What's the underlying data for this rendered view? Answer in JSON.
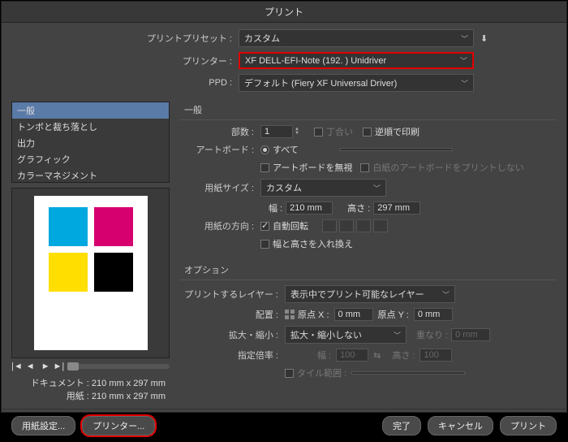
{
  "title": "プリント",
  "presets": {
    "label": "プリントプリセット :",
    "value": "カスタム"
  },
  "printer": {
    "label": "プリンター :",
    "value": "XF DELL-EFI-Note (192.              ) Unidriver"
  },
  "ppd": {
    "label": "PPD :",
    "value": "デフォルト (Fiery XF Universal Driver)"
  },
  "categories": [
    "一般",
    "トンボと裁ち落とし",
    "出力",
    "グラフィック",
    "カラーマネジメント",
    "…"
  ],
  "previewInfo": {
    "docLabel": "ドキュメント :",
    "docSize": "210 mm x 297 mm",
    "mediaLabel": "用紙 :",
    "mediaSize": "210 mm x 297 mm"
  },
  "general": {
    "title": "一般",
    "copies": {
      "label": "部数 :",
      "value": "1",
      "collate": "丁合い",
      "reverse": "逆順で印刷"
    },
    "artboard": {
      "label": "アートボード :",
      "all": "すべて",
      "ignore": "アートボードを無視",
      "blank": "白紙のアートボードをプリントしない"
    },
    "mediaSize": {
      "label": "用紙サイズ :",
      "value": "カスタム",
      "wLabel": "幅 :",
      "wVal": "210 mm",
      "hLabel": "高さ :",
      "hVal": "297 mm"
    },
    "orient": {
      "label": "用紙の方向 :",
      "auto": "自動回転",
      "swap": "幅と高さを入れ換え"
    }
  },
  "options": {
    "title": "オプション",
    "layers": {
      "label": "プリントするレイヤー :",
      "value": "表示中でプリント可能なレイヤー"
    },
    "placement": {
      "label": "配置 :",
      "xLabel": "原点 X :",
      "xVal": "0 mm",
      "yLabel": "原点 Y :",
      "yVal": "0 mm"
    },
    "scale": {
      "label": "拡大・縮小 :",
      "value": "拡大・縮小しない",
      "overlap": "重なり :",
      "overlapVal": "0 mm"
    },
    "ratio": {
      "label": "指定倍率 :",
      "wLabel": "幅 :",
      "wVal": "100",
      "hLabel": "高さ :",
      "hVal": "100"
    },
    "tile": {
      "label": "タイル範囲 :"
    }
  },
  "buttons": {
    "pageSetup": "用紙設定...",
    "printer": "プリンター...",
    "done": "完了",
    "cancel": "キャンセル",
    "print": "プリント"
  }
}
